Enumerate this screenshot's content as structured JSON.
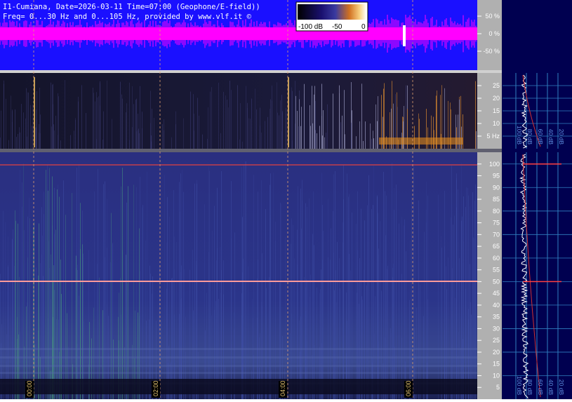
{
  "header": {
    "line1": "I1-Cumiana, Date=2026-03-11 Time=07:00 (Geophone/E-field))",
    "line2": "Freq= 0...30 Hz and 0...105 Hz, provided by www.vlf.it ©"
  },
  "colorbar": {
    "labels": [
      "-100 dB",
      "-50",
      "0"
    ]
  },
  "chart_data": [
    {
      "type": "area",
      "panel": "waveform",
      "ylabels": [
        "50 %",
        "0 %",
        "-50 %"
      ],
      "yticks": [
        50,
        0,
        -50
      ],
      "ylim": [
        -100,
        100
      ],
      "colors": {
        "background": "#1a10ff",
        "trace": "#ff00ff"
      }
    },
    {
      "type": "heatmap",
      "panel": "spectrogram-low",
      "yticks": [
        25,
        20,
        15,
        10,
        5
      ],
      "ylabels": [
        "25",
        "20",
        "15",
        "10",
        "5 Hz"
      ],
      "ylim": [
        0,
        30
      ],
      "profile_xlabels": [
        "100 dB",
        "80 dB",
        "60 dB",
        "40 dB",
        "20 dB"
      ]
    },
    {
      "type": "heatmap",
      "panel": "spectrogram-high",
      "yticks": [
        100,
        95,
        90,
        85,
        80,
        75,
        70,
        65,
        60,
        55,
        50,
        45,
        40,
        35,
        30,
        25,
        20,
        15,
        10,
        5
      ],
      "ylim": [
        0,
        105
      ],
      "xticks": [
        "00:00",
        "02:00",
        "04:00",
        "06:00"
      ],
      "profile_xlabels": [
        "100 dB",
        "80 dB",
        "60 dB",
        "40 dB",
        "20 dB"
      ]
    }
  ]
}
